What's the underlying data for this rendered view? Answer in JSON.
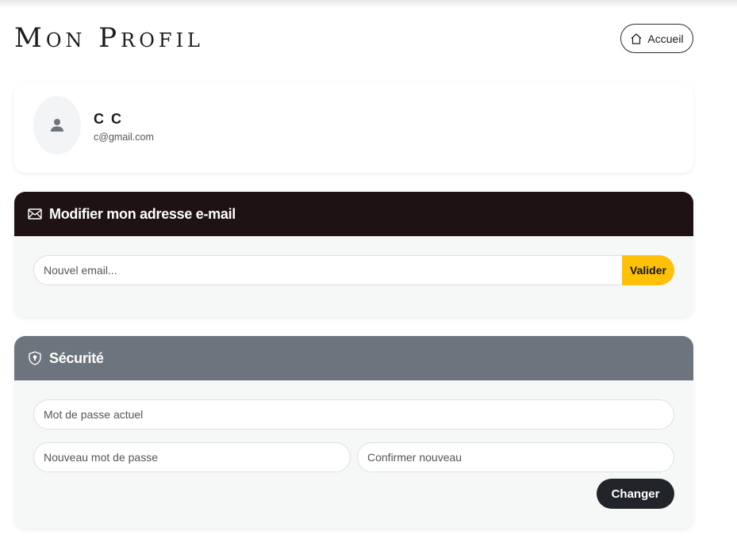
{
  "page": {
    "title": "Mon Profil",
    "home_button_label": "Accueil"
  },
  "profile": {
    "name": "C C",
    "email": "c@gmail.com"
  },
  "email_section": {
    "title": "Modifier mon adresse e-mail",
    "input_placeholder": "Nouvel email...",
    "submit_label": "Valider"
  },
  "security_section": {
    "title": "Sécurité",
    "current_password_placeholder": "Mot de passe actuel",
    "new_password_placeholder": "Nouveau mot de passe",
    "confirm_password_placeholder": "Confirmer nouveau",
    "submit_label": "Changer"
  },
  "icons": {
    "home": "home-icon",
    "avatar": "person-icon",
    "email": "envelope-icon",
    "security": "shield-icon"
  },
  "colors": {
    "email_header": "#1e1214",
    "security_header": "#6c757d",
    "valider_button": "#ffc107",
    "changer_button": "#212529"
  }
}
